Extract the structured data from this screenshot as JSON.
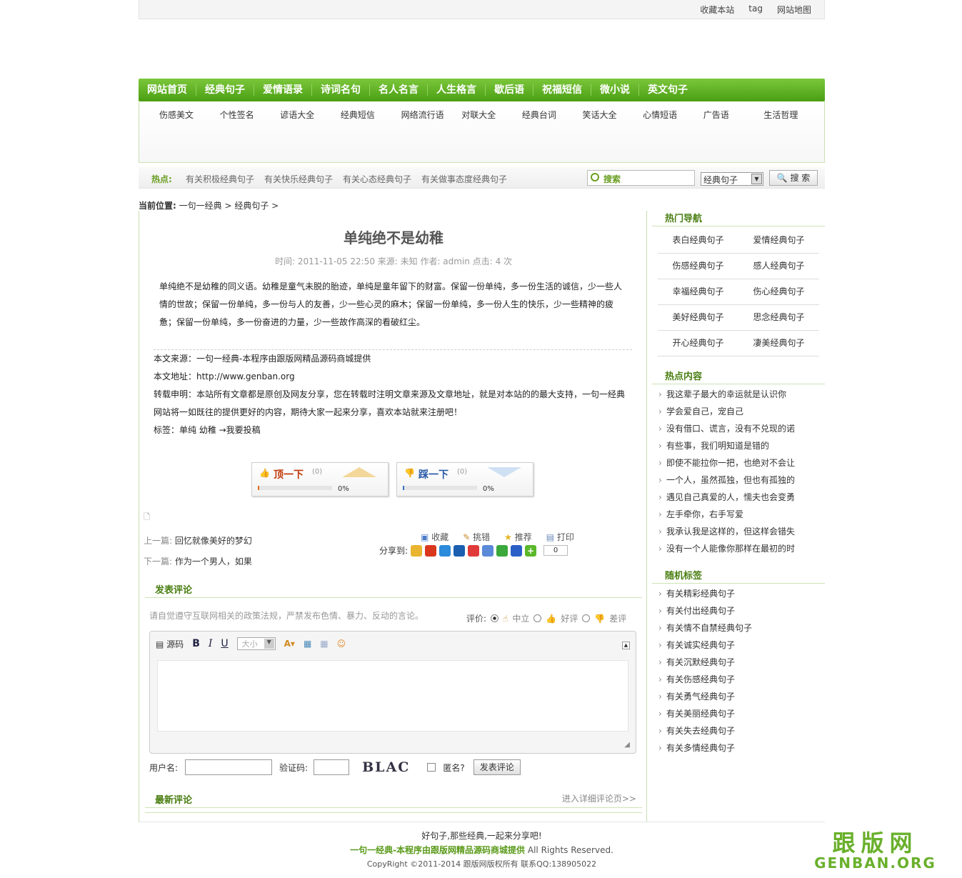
{
  "topbar": {
    "links": [
      "收藏本站",
      "tag",
      "网站地图"
    ]
  },
  "nav": {
    "items": [
      "网站首页",
      "经典句子",
      "爱情语录",
      "诗词名句",
      "名人名言",
      "人生格言",
      "歇后语",
      "祝福短信",
      "微小说",
      "英文句子"
    ]
  },
  "subnav": {
    "items": [
      "伤感美文",
      "个性签名",
      "谚语大全",
      "经典短信",
      "网络流行语",
      "对联大全",
      "经典台词",
      "笑话大全",
      "心情短语",
      "广告语",
      "生活哲理"
    ]
  },
  "hot": {
    "label": "热点:",
    "items": [
      "有关积极经典句子",
      "有关快乐经典句子",
      "有关心态经典句子",
      "有关做事态度经典句子"
    ]
  },
  "search": {
    "placeholder": "搜索",
    "select": "经典句子",
    "button": "搜 索"
  },
  "crumb": {
    "label": "当前位置:",
    "path": "一句一经典 > 经典句子 >"
  },
  "article": {
    "title": "单纯绝不是幼稚",
    "meta": "时间: 2011-11-05 22:50  来源: 未知   作者: admin   点击:  4 次",
    "body": "单纯绝不是幼稚的同义语。幼稚是童气未脱的胎迹，单纯是童年留下的财富。保留一份单纯，多一份生活的诚信，少一些人情的世故；保留一份单纯，多一份与人的友善，少一些心灵的麻木；保留一份单纯，多一份人生的快乐，少一些精神的疲惫；保留一份单纯，多一份奋进的力量，少一些故作高深的看破红尘。",
    "source": "本文来源：一句一经典-本程序由跟版网精品源码商城提供",
    "url": "本文地址：http://www.genban.org",
    "statement": "转载申明：本站所有文章都是原创及网友分享，您在转载时注明文章来源及文章地址，就是对本站的的最大支持，一句一经典网站将一如既往的提供更好的内容，期待大家一起来分享，喜欢本站就来注册吧！",
    "tags": "标签：单纯 幼稚 →我要投稿"
  },
  "vote": {
    "up_label": "顶一下",
    "up_count": "(0)",
    "up_pct": "0%",
    "down_label": "踩一下",
    "down_count": "(0)",
    "down_pct": "0%"
  },
  "prev": {
    "label": "上一篇:",
    "title": "回忆就像美好的梦幻"
  },
  "next": {
    "label": "下一篇:",
    "title": "作为一个男人，如果"
  },
  "tools": [
    "收藏",
    "挑错",
    "推荐",
    "打印"
  ],
  "share": {
    "label": "分享到:",
    "count": "0"
  },
  "comment": {
    "title": "发表评论",
    "notice": "请自觉遵守互联网相关的政策法规，严禁发布色情、暴力、反动的言论。",
    "rating_label": "评价:",
    "ratings": [
      "中立",
      "好评",
      "差评"
    ],
    "source_btn": "源码",
    "size": "大小",
    "user_label": "用户名:",
    "code_label": "验证码:",
    "captcha": "BLAC",
    "anon": "匿名?",
    "submit": "发表评论"
  },
  "latest": {
    "title": "最新评论",
    "more": "进入详细评论页>>"
  },
  "sidebar": {
    "nav_title": "热门导航",
    "nav": [
      "表白经典句子",
      "爱情经典句子",
      "伤感经典句子",
      "感人经典句子",
      "幸福经典句子",
      "伤心经典句子",
      "美好经典句子",
      "思念经典句子",
      "开心经典句子",
      "凄美经典句子"
    ],
    "hot_title": "热点内容",
    "hot": [
      "我这辈子最大的幸运就是认识你",
      "学会爱自己，宠自己",
      "没有借口、谎言，没有不兑现的诺",
      "有些事，我们明知道是错的",
      "即使不能拉你一把，也绝对不会让",
      "一个人，虽然孤独，但也有孤独的",
      "遇见自己真爱的人，懦夫也会变勇",
      "左手牵你，右手写爱",
      "我承认我是这样的，但这样会错失",
      "没有一个人能像你那样在最初的时"
    ],
    "tag_title": "随机标签",
    "tags": [
      "有关精彩经典句子",
      "有关付出经典句子",
      "有关情不自禁经典句子",
      "有关诚实经典句子",
      "有关沉默经典句子",
      "有关伤感经典句子",
      "有关勇气经典句子",
      "有关美丽经典句子",
      "有关失去经典句子",
      "有关多情经典句子"
    ]
  },
  "footer": {
    "line1": "好句子,那些经典,一起来分享吧!",
    "line2_bold": "一句一经典-本程序由跟版网精品源码商城提供",
    "line2_rest": " All Rights Reserved.",
    "line3": "CopyRight ©2011-2014 跟版网版权所有 联系QQ:138905022"
  },
  "logo": {
    "cn": "跟版网",
    "en": "GENBAN.ORG"
  },
  "colors": {
    "brand_green": "#5aa81c",
    "link_green": "#4a7e12"
  }
}
